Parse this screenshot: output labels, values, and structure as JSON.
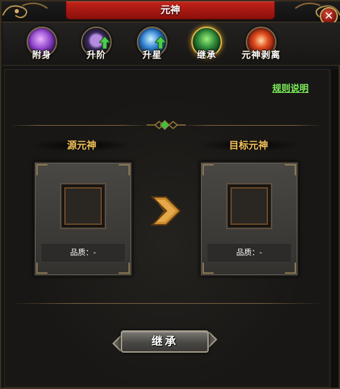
{
  "window": {
    "title": "元神",
    "close_label": "✕"
  },
  "tabs": [
    {
      "label": "附身",
      "icon": "possess-orb-icon",
      "active": false,
      "color": "#8a3fc8"
    },
    {
      "label": "升阶",
      "icon": "advance-orb-icon",
      "active": false,
      "color": "#3a2a5a"
    },
    {
      "label": "升星",
      "icon": "star-orb-icon",
      "active": false,
      "color": "#2f7fd0"
    },
    {
      "label": "继承",
      "icon": "inherit-orb-icon",
      "active": true,
      "color": "#2f8a3a"
    },
    {
      "label": "元神剥离",
      "icon": "strip-orb-icon",
      "active": false,
      "color": "#c0281e"
    }
  ],
  "rules_link": "规则说明",
  "source_slot": {
    "title": "源元神",
    "quality_text": "品质：-"
  },
  "target_slot": {
    "title": "目标元神",
    "quality_text": "品质：-"
  },
  "inherit_button": "继承",
  "colors": {
    "title_red": "#b81c14",
    "gold_text": "#f2c05a",
    "link_green": "#7cf05a",
    "arrow_orange": "#d08a2a"
  }
}
